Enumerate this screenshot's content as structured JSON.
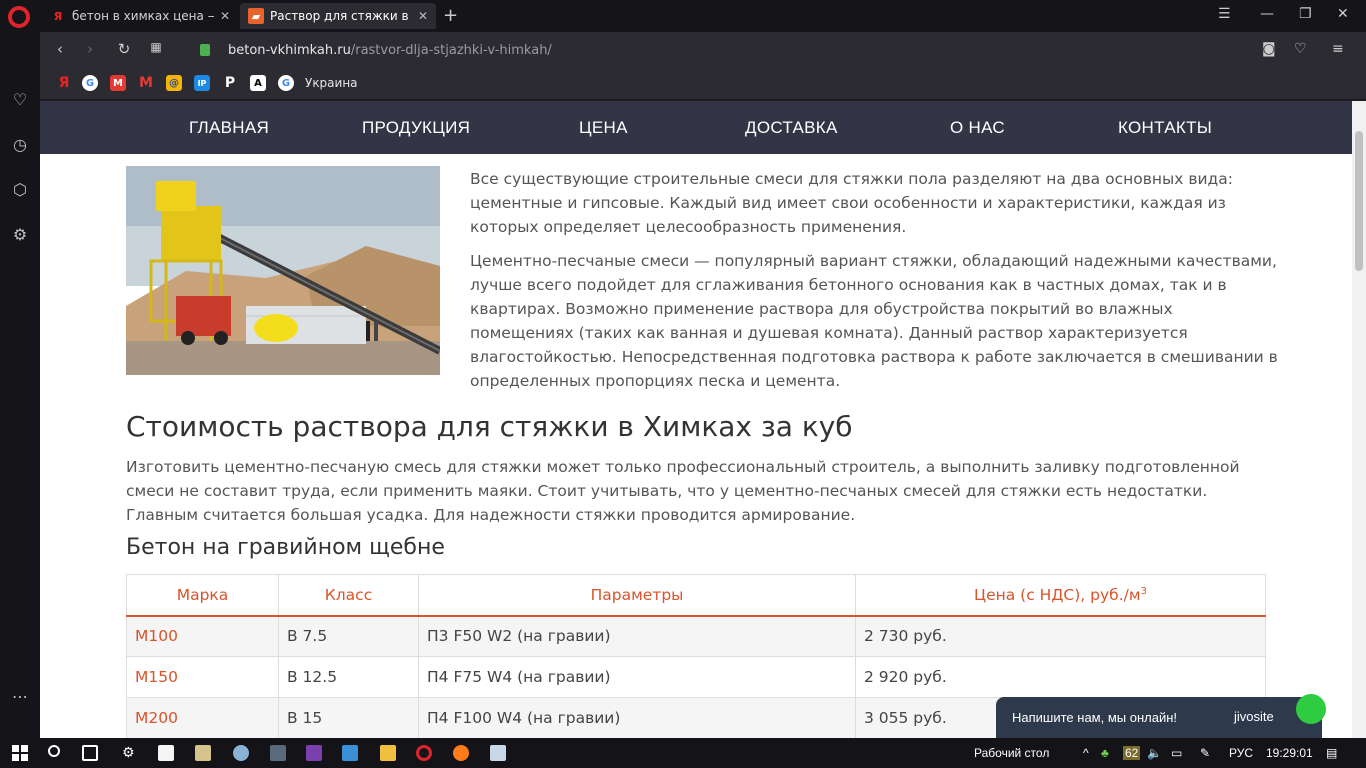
{
  "browser": {
    "tabs": [
      {
        "title": "бетон в химках цена — Ян",
        "favicon": "yandex-icon"
      },
      {
        "title": "Раствор для стяжки в Хим",
        "favicon": "site-icon"
      }
    ],
    "url_host": "beton-vkhimkah.ru",
    "url_path": "/rastvor-dlja-stjazhki-v-himkah/",
    "bookmark_label": "Украина"
  },
  "nav": {
    "items": [
      "ГЛАВНАЯ",
      "ПРОДУКЦИЯ",
      "ЦЕНА",
      "ДОСТАВКА",
      "О НАС",
      "КОНТАКТЫ"
    ]
  },
  "content": {
    "para1": "Все существующие строительные смеси для стяжки пола разделяют на два основных вида: цементные и гипсовые. Каждый вид имеет свои особенности и характеристики, каждая из которых определяет целесообразность применения.",
    "para2": "Цементно-песчаные смеси — популярный вариант стяжки, обладающий надежными качествами, лучше всего подойдет для сглаживания бетонного основания как в частных домах, так и в квартирах. Возможно применение раствора для обустройства покрытий во влажных помещениях (таких как ванная и душевая комната). Данный раствор характеризуется влагостойкостью. Непосредственная подготовка раствора к работе заключается в смешивании в определенных пропорциях песка и цемента.",
    "heading": "Стоимость раствора для стяжки в Химках за куб",
    "para3": "Изготовить цементно-песчаную смесь для стяжки может только профессиональный строитель, а выполнить заливку подготовленной смеси не составит труда, если применить маяки. Стоит учитывать, что у цементно-песчаных смесей для стяжки есть недостатки. Главным считается большая усадка. Для надежности стяжки проводится армирование.",
    "subheading": "Бетон на гравийном щебне"
  },
  "table": {
    "headers": [
      "Марка",
      "Класс",
      "Параметры",
      "Цена (с НДС), руб./м",
      "3"
    ],
    "rows": [
      [
        "М100",
        "В 7.5",
        "П3 F50 W2 (на гравии)",
        "2 730 руб."
      ],
      [
        "М150",
        "В 12.5",
        "П4 F75 W4 (на гравии)",
        "2 920 руб."
      ],
      [
        "М200",
        "В 15",
        "П4 F100 W4 (на гравии)",
        "3 055 руб."
      ]
    ]
  },
  "chat": {
    "text": "Напишите нам, мы онлайн!",
    "brand": "jivosite"
  },
  "taskbar": {
    "desktop_label": "Рабочий стол",
    "battery": "62",
    "lang": "РУС",
    "time": "19:29:01"
  },
  "colors": {
    "accent": "#d9542b",
    "nav_bg": "#343447"
  }
}
